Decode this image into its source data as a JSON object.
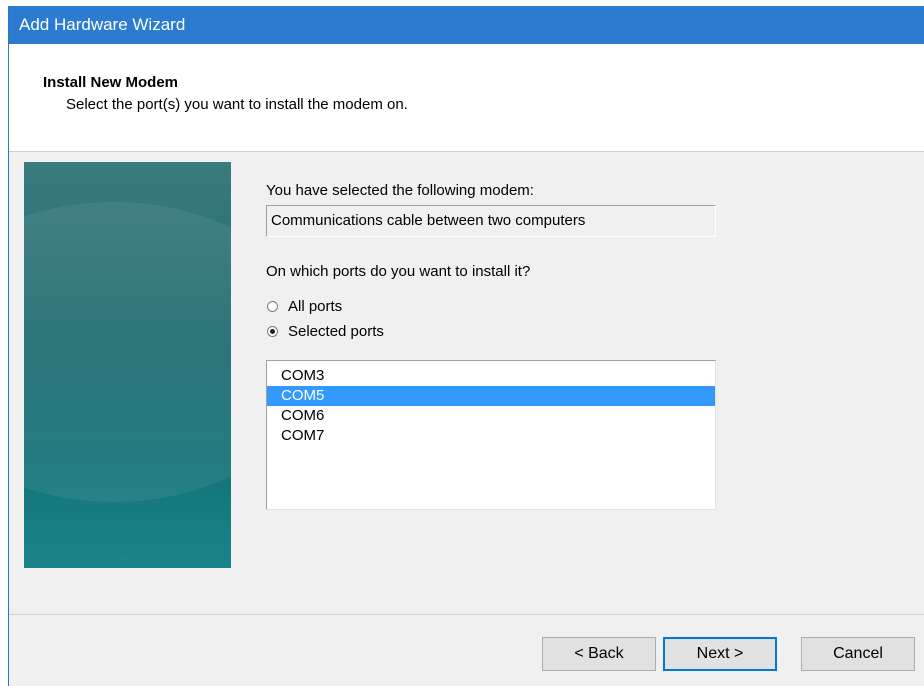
{
  "window": {
    "title": "Add Hardware Wizard"
  },
  "header": {
    "title": "Install New Modem",
    "subtitle": "Select the port(s) you want to install the modem on."
  },
  "content": {
    "selected_modem_label": "You have selected the following modem:",
    "selected_modem_value": "Communications cable between two computers",
    "ports_question": "On which ports do you want to install it?",
    "radio_options": [
      {
        "label": "All ports",
        "checked": false
      },
      {
        "label": "Selected ports",
        "checked": true
      }
    ],
    "ports": [
      "COM3",
      "COM5",
      "COM6",
      "COM7"
    ],
    "selected_port": "COM5"
  },
  "buttons": {
    "back": "< Back",
    "next": "Next >",
    "cancel": "Cancel"
  },
  "colors": {
    "titlebar": "#2b7bd0",
    "selection": "#3399ff",
    "default_button_border": "#0078d7",
    "side_panel": "#1d6b6f"
  }
}
